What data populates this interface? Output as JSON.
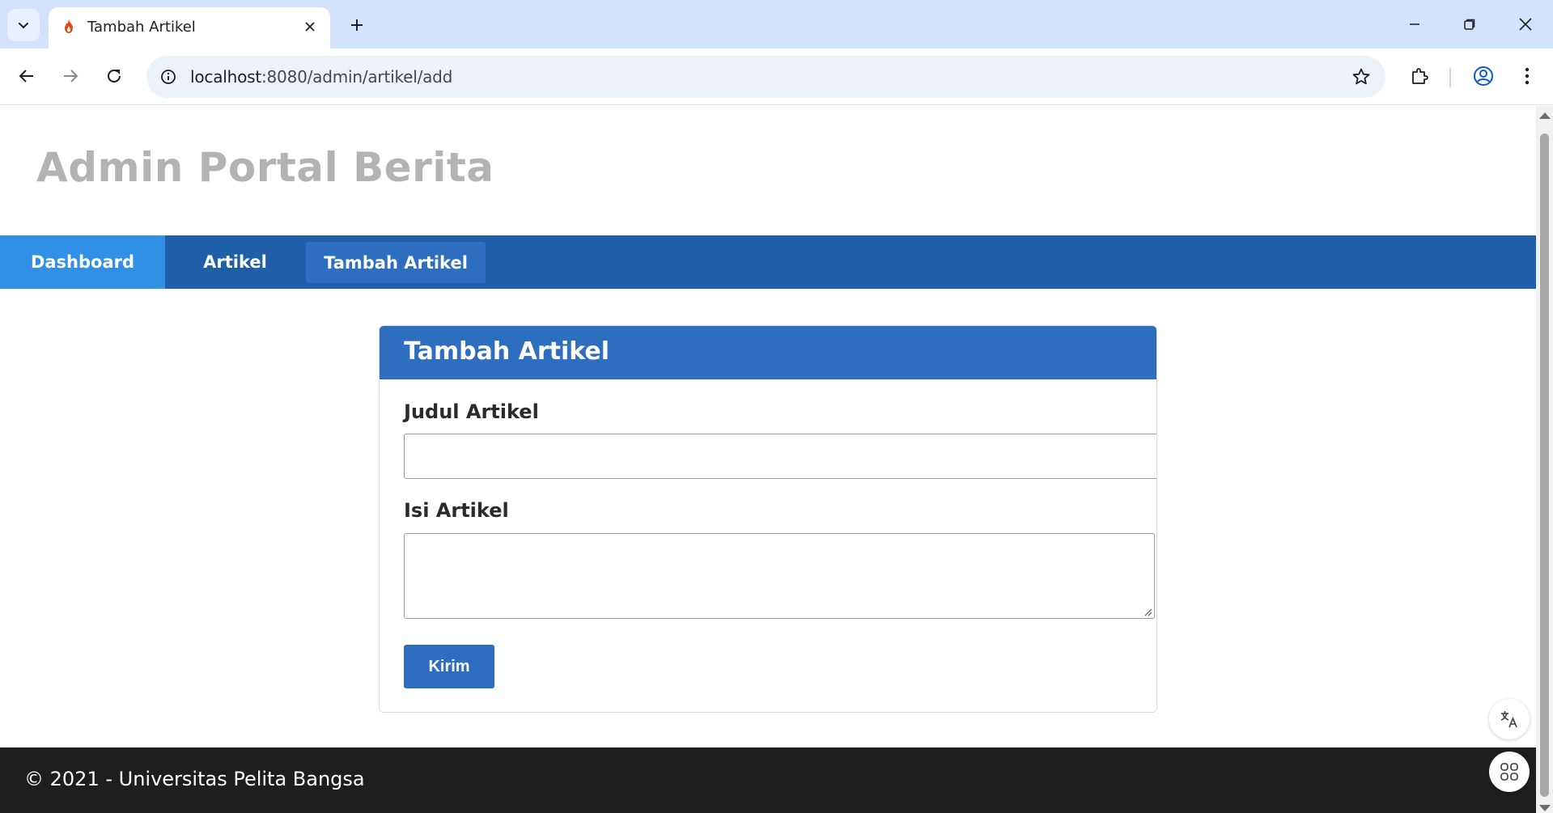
{
  "browser": {
    "tab_title": "Tambah Artikel",
    "url_host": "localhost",
    "url_rest": ":8080/admin/artikel/add"
  },
  "site": {
    "title": "Admin Portal Berita"
  },
  "nav": {
    "items": [
      {
        "label": "Dashboard"
      },
      {
        "label": "Artikel"
      },
      {
        "label": "Tambah Artikel"
      }
    ]
  },
  "form": {
    "heading": "Tambah Artikel",
    "judul_label": "Judul Artikel",
    "judul_value": "",
    "isi_label": "Isi Artikel",
    "isi_value": "",
    "submit_label": "Kirim"
  },
  "footer": {
    "text": "© 2021 - Universitas Pelita Bangsa"
  },
  "colors": {
    "navbar": "#1f5fa8",
    "nav_active": "#3090e6",
    "card_header": "#2d6ebe",
    "footer": "#1e1e1e",
    "site_title": "#b3b3b3"
  },
  "icons": {
    "tab_search": "chevron-down-icon",
    "favicon": "flame-icon",
    "close": "close-icon",
    "new_tab": "plus-icon",
    "back": "arrow-left-icon",
    "forward": "arrow-right-icon",
    "reload": "reload-icon",
    "site_info": "info-icon",
    "bookmark": "star-icon",
    "extensions": "puzzle-icon",
    "profile": "profile-icon",
    "menu": "kebab-menu-icon",
    "translate": "translate-icon",
    "apps": "apps-icon"
  }
}
